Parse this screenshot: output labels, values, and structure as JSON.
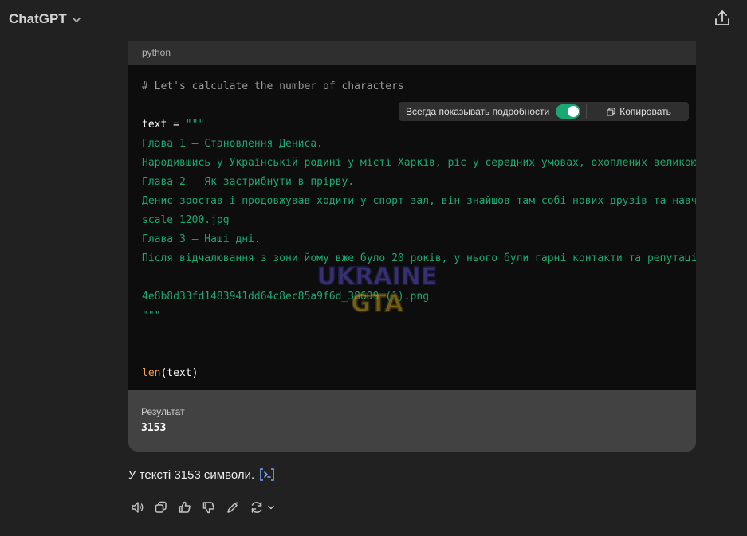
{
  "header": {
    "model_name": "ChatGPT"
  },
  "codeblock": {
    "language": "python",
    "lines": [
      {
        "text": "# Let's calculate the number of characters",
        "kind": "comment"
      },
      {
        "text": "",
        "kind": "blank"
      },
      {
        "text": "text = \"\"\"",
        "kind": "assign"
      },
      {
        "text": "Глава 1 – Становлення Дениса.",
        "kind": "string"
      },
      {
        "text": "Народившись у Українській родині у місті Харків, ріс у середних умовах, охоплених великою н",
        "kind": "string"
      },
      {
        "text": "Глава 2 – Як застрибнути в прірву.",
        "kind": "string"
      },
      {
        "text": "Денис зростав і продовжував ходити у спорт зал, він знайшов там собі нових друзів та навчив",
        "kind": "string"
      },
      {
        "text": "scale_1200.jpg",
        "kind": "string"
      },
      {
        "text": "Глава 3 – Наші дні.",
        "kind": "string"
      },
      {
        "text": "Після відчалювання з зони йому вже було 20 років, у нього були гарні контакти та репутація",
        "kind": "string"
      },
      {
        "text": "",
        "kind": "blank"
      },
      {
        "text": "4e8b8d33fd1483941dd64c8ec85a9f6d_38699 (1).png",
        "kind": "string"
      },
      {
        "text": "\"\"\"",
        "kind": "string"
      },
      {
        "text": "",
        "kind": "blank"
      },
      {
        "text": "",
        "kind": "blank"
      },
      {
        "text": "len(text)",
        "kind": "call"
      }
    ],
    "overlay": {
      "toggle_label": "Всегда показывать подробности",
      "copy_label": "Копировать"
    },
    "result_label": "Результат",
    "result_value": "3153"
  },
  "answer": {
    "text": "У тексті 3153 символи."
  },
  "watermark": {
    "line1": "UKRAINE",
    "line2": "GTA"
  },
  "colors": {
    "background": "#212121",
    "code_bg": "#0d0d0d",
    "string": "#19a872",
    "function": "#f0a04b",
    "toggle_on": "#19a872",
    "result_bg": "#424242"
  }
}
